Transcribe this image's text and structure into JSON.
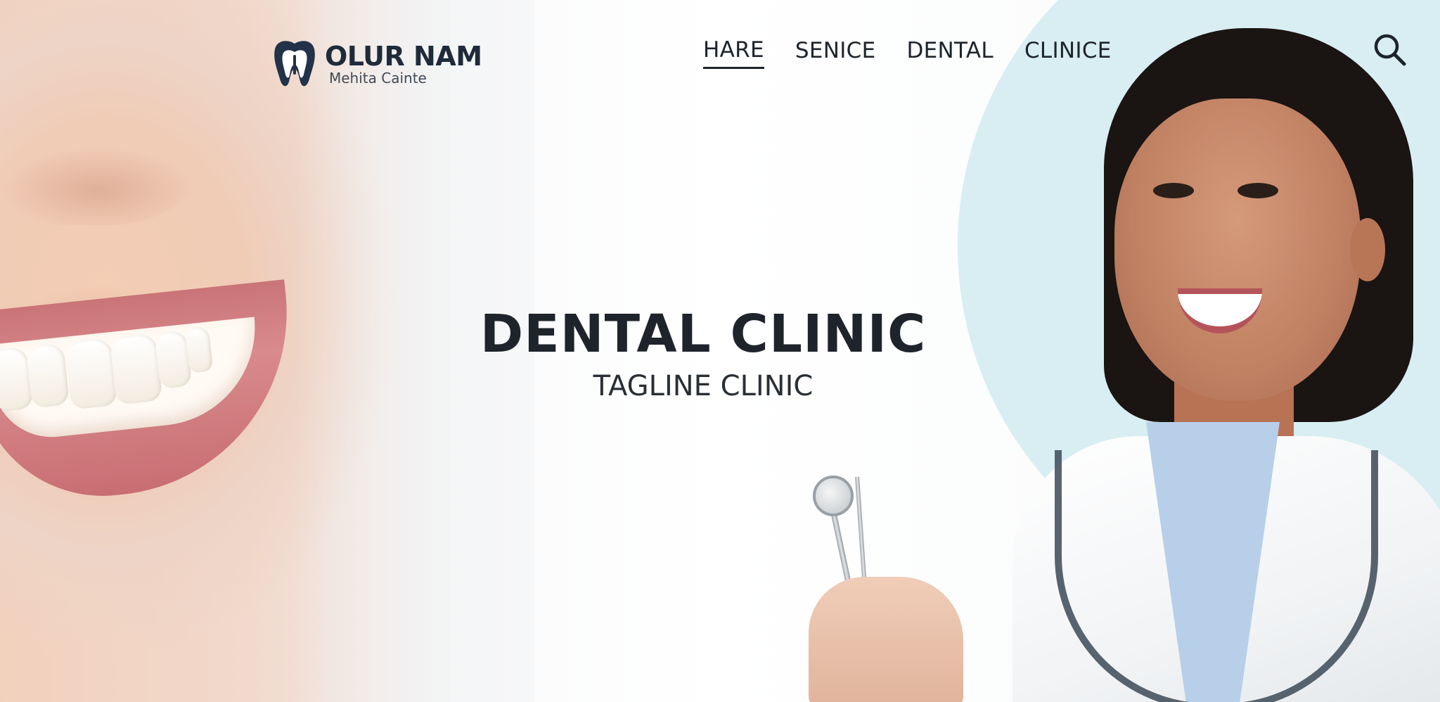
{
  "brand": {
    "name": "OLUR NAM",
    "subtitle": "Mehita Cainte",
    "icon": "tooth-logo-icon",
    "color": "#1f2b3a"
  },
  "nav": {
    "items": [
      {
        "label": "HARE",
        "active": true
      },
      {
        "label": "SENICE",
        "active": false
      },
      {
        "label": "DENTAL",
        "active": false
      },
      {
        "label": "CLINICE",
        "active": false
      }
    ],
    "search_icon": "search-icon"
  },
  "hero": {
    "title": "DENTAL CLINIC",
    "tagline": "TAGLINE CLINIC"
  },
  "colors": {
    "accent_circle": "#d8eef3",
    "text_dark": "#1f232b"
  }
}
